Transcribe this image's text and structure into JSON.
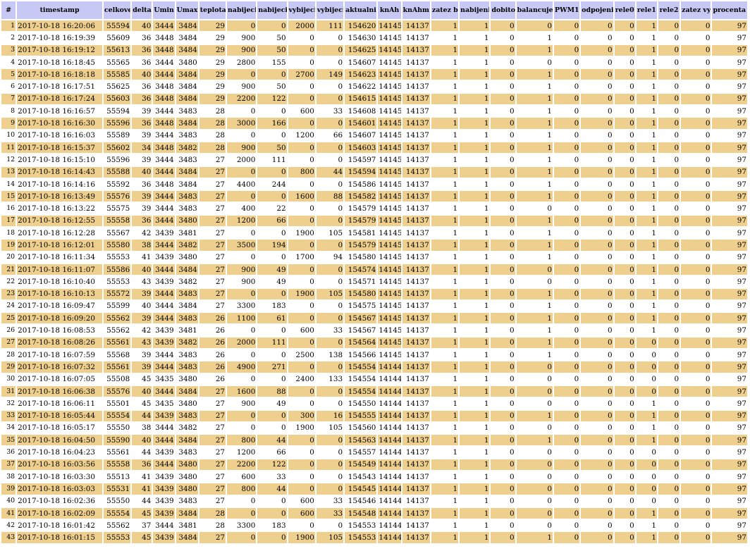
{
  "columns": [
    "#",
    "timestamp",
    "celkove napeti",
    "delta U",
    "Umin",
    "Umax",
    "teplota",
    "nabijeci proud",
    "nabijeci vykon",
    "vybijeci proud",
    "vybijeci vykon",
    "aktualni naboj",
    "knAh",
    "knAhm",
    "zatez bistabil",
    "nabijeni bistabil",
    "dobito",
    "balancuje",
    "PWM1",
    "odpojeni baterie",
    "rele0",
    "rele1",
    "rele2",
    "zatez vypnuta",
    "procenta baterie"
  ],
  "rows": [
    [
      "1",
      "2017-10-18 16:20:06",
      "55594",
      "40",
      "3444",
      "3484",
      "29",
      "0",
      "0",
      "2000",
      "111",
      "154620",
      "14145",
      "14137",
      "1",
      "1",
      "0",
      "0",
      "0",
      "0",
      "0",
      "1",
      "0",
      "0",
      "97"
    ],
    [
      "2",
      "2017-10-18 16:19:39",
      "55609",
      "36",
      "3448",
      "3484",
      "29",
      "900",
      "50",
      "0",
      "0",
      "154630",
      "14145",
      "14137",
      "1",
      "1",
      "0",
      "1",
      "0",
      "0",
      "0",
      "1",
      "0",
      "0",
      "97"
    ],
    [
      "3",
      "2017-10-18 16:19:12",
      "55613",
      "36",
      "3448",
      "3484",
      "29",
      "900",
      "50",
      "0",
      "0",
      "154625",
      "14145",
      "14137",
      "1",
      "1",
      "0",
      "1",
      "0",
      "0",
      "0",
      "1",
      "0",
      "0",
      "97"
    ],
    [
      "4",
      "2017-10-18 16:18:45",
      "55565",
      "36",
      "3444",
      "3480",
      "29",
      "2800",
      "155",
      "0",
      "0",
      "154607",
      "14145",
      "14137",
      "1",
      "1",
      "0",
      "0",
      "0",
      "0",
      "0",
      "1",
      "0",
      "0",
      "97"
    ],
    [
      "5",
      "2017-10-18 16:18:18",
      "55585",
      "40",
      "3444",
      "3484",
      "29",
      "0",
      "0",
      "2700",
      "149",
      "154623",
      "14145",
      "14137",
      "1",
      "1",
      "0",
      "1",
      "0",
      "0",
      "0",
      "1",
      "0",
      "0",
      "97"
    ],
    [
      "6",
      "2017-10-18 16:17:51",
      "55625",
      "36",
      "3448",
      "3484",
      "29",
      "900",
      "50",
      "0",
      "0",
      "154622",
      "14145",
      "14137",
      "1",
      "1",
      "0",
      "1",
      "0",
      "0",
      "0",
      "1",
      "0",
      "0",
      "97"
    ],
    [
      "7",
      "2017-10-18 16:17:24",
      "55603",
      "36",
      "3448",
      "3484",
      "29",
      "2200",
      "122",
      "0",
      "0",
      "154615",
      "14145",
      "14137",
      "1",
      "1",
      "0",
      "1",
      "0",
      "0",
      "0",
      "1",
      "0",
      "0",
      "97"
    ],
    [
      "8",
      "2017-10-18 16:16:57",
      "55594",
      "39",
      "3444",
      "3483",
      "28",
      "0",
      "0",
      "600",
      "33",
      "154608",
      "14145",
      "14137",
      "1",
      "1",
      "0",
      "1",
      "0",
      "0",
      "0",
      "1",
      "0",
      "0",
      "97"
    ],
    [
      "9",
      "2017-10-18 16:16:30",
      "55596",
      "36",
      "3448",
      "3484",
      "28",
      "3000",
      "166",
      "0",
      "0",
      "154601",
      "14145",
      "14137",
      "1",
      "1",
      "0",
      "1",
      "0",
      "0",
      "0",
      "1",
      "0",
      "0",
      "97"
    ],
    [
      "10",
      "2017-10-18 16:16:03",
      "55589",
      "39",
      "3444",
      "3483",
      "28",
      "0",
      "0",
      "1200",
      "66",
      "154607",
      "14145",
      "14137",
      "1",
      "1",
      "0",
      "1",
      "0",
      "0",
      "0",
      "1",
      "0",
      "0",
      "97"
    ],
    [
      "11",
      "2017-10-18 16:15:37",
      "55602",
      "34",
      "3448",
      "3482",
      "28",
      "900",
      "50",
      "0",
      "0",
      "154603",
      "14145",
      "14137",
      "1",
      "1",
      "0",
      "1",
      "0",
      "0",
      "0",
      "1",
      "0",
      "0",
      "97"
    ],
    [
      "12",
      "2017-10-18 16:15:10",
      "55596",
      "39",
      "3444",
      "3483",
      "27",
      "2000",
      "111",
      "0",
      "0",
      "154597",
      "14145",
      "14137",
      "1",
      "1",
      "0",
      "1",
      "0",
      "0",
      "0",
      "1",
      "0",
      "0",
      "97"
    ],
    [
      "13",
      "2017-10-18 16:14:43",
      "55588",
      "40",
      "3444",
      "3484",
      "27",
      "0",
      "0",
      "800",
      "44",
      "154594",
      "14145",
      "14137",
      "1",
      "1",
      "0",
      "1",
      "0",
      "0",
      "0",
      "1",
      "0",
      "0",
      "97"
    ],
    [
      "14",
      "2017-10-18 16:14:16",
      "55592",
      "36",
      "3448",
      "3484",
      "27",
      "4400",
      "244",
      "0",
      "0",
      "154586",
      "14145",
      "14137",
      "1",
      "1",
      "0",
      "1",
      "0",
      "0",
      "0",
      "1",
      "0",
      "0",
      "97"
    ],
    [
      "15",
      "2017-10-18 16:13:49",
      "55576",
      "39",
      "3444",
      "3483",
      "27",
      "0",
      "0",
      "1600",
      "88",
      "154582",
      "14145",
      "14137",
      "1",
      "1",
      "0",
      "1",
      "0",
      "0",
      "0",
      "1",
      "0",
      "0",
      "97"
    ],
    [
      "16",
      "2017-10-18 16:13:22",
      "55575",
      "39",
      "3444",
      "3483",
      "27",
      "400",
      "22",
      "0",
      "0",
      "154579",
      "14145",
      "14137",
      "1",
      "1",
      "0",
      "0",
      "0",
      "0",
      "0",
      "1",
      "0",
      "0",
      "97"
    ],
    [
      "17",
      "2017-10-18 16:12:55",
      "55558",
      "36",
      "3444",
      "3480",
      "27",
      "1200",
      "66",
      "0",
      "0",
      "154579",
      "14145",
      "14137",
      "1",
      "1",
      "0",
      "1",
      "0",
      "0",
      "0",
      "1",
      "0",
      "0",
      "97"
    ],
    [
      "18",
      "2017-10-18 16:12:28",
      "55567",
      "42",
      "3439",
      "3481",
      "27",
      "0",
      "0",
      "1900",
      "105",
      "154581",
      "14145",
      "14137",
      "1",
      "1",
      "0",
      "1",
      "0",
      "0",
      "0",
      "1",
      "0",
      "0",
      "97"
    ],
    [
      "19",
      "2017-10-18 16:12:01",
      "55580",
      "38",
      "3444",
      "3482",
      "27",
      "3500",
      "194",
      "0",
      "0",
      "154579",
      "14145",
      "14137",
      "1",
      "1",
      "0",
      "1",
      "0",
      "0",
      "0",
      "1",
      "0",
      "0",
      "97"
    ],
    [
      "20",
      "2017-10-18 16:11:34",
      "55553",
      "41",
      "3439",
      "3480",
      "27",
      "0",
      "0",
      "1700",
      "94",
      "154580",
      "14145",
      "14137",
      "1",
      "1",
      "0",
      "1",
      "0",
      "0",
      "0",
      "1",
      "0",
      "0",
      "97"
    ],
    [
      "21",
      "2017-10-18 16:11:07",
      "55586",
      "40",
      "3444",
      "3484",
      "27",
      "900",
      "49",
      "0",
      "0",
      "154574",
      "14145",
      "14137",
      "1",
      "1",
      "0",
      "0",
      "0",
      "0",
      "0",
      "1",
      "0",
      "0",
      "97"
    ],
    [
      "22",
      "2017-10-18 16:10:40",
      "55553",
      "43",
      "3439",
      "3482",
      "27",
      "900",
      "49",
      "0",
      "0",
      "154571",
      "14145",
      "14137",
      "1",
      "1",
      "0",
      "0",
      "0",
      "0",
      "0",
      "1",
      "0",
      "0",
      "97"
    ],
    [
      "23",
      "2017-10-18 16:10:13",
      "55572",
      "39",
      "3444",
      "3483",
      "27",
      "0",
      "0",
      "1900",
      "105",
      "154580",
      "14145",
      "14137",
      "1",
      "1",
      "0",
      "1",
      "0",
      "0",
      "0",
      "1",
      "0",
      "0",
      "97"
    ],
    [
      "24",
      "2017-10-18 16:09:47",
      "55599",
      "40",
      "3444",
      "3484",
      "27",
      "3300",
      "183",
      "0",
      "0",
      "154575",
      "14145",
      "14137",
      "1",
      "1",
      "0",
      "1",
      "0",
      "0",
      "0",
      "1",
      "0",
      "0",
      "97"
    ],
    [
      "25",
      "2017-10-18 16:09:20",
      "55562",
      "39",
      "3444",
      "3483",
      "26",
      "1100",
      "61",
      "0",
      "0",
      "154567",
      "14145",
      "14137",
      "1",
      "1",
      "0",
      "1",
      "0",
      "0",
      "0",
      "1",
      "0",
      "0",
      "97"
    ],
    [
      "26",
      "2017-10-18 16:08:53",
      "55562",
      "42",
      "3439",
      "3481",
      "26",
      "0",
      "0",
      "600",
      "33",
      "154567",
      "14145",
      "14137",
      "1",
      "1",
      "0",
      "1",
      "0",
      "0",
      "0",
      "1",
      "0",
      "0",
      "97"
    ],
    [
      "27",
      "2017-10-18 16:08:26",
      "55561",
      "43",
      "3439",
      "3482",
      "26",
      "2000",
      "111",
      "0",
      "0",
      "154564",
      "14145",
      "14137",
      "1",
      "1",
      "0",
      "1",
      "0",
      "0",
      "0",
      "0",
      "0",
      "0",
      "97"
    ],
    [
      "28",
      "2017-10-18 16:07:59",
      "55568",
      "39",
      "3444",
      "3483",
      "26",
      "0",
      "0",
      "2500",
      "138",
      "154566",
      "14145",
      "14137",
      "1",
      "1",
      "0",
      "1",
      "0",
      "0",
      "0",
      "0",
      "0",
      "0",
      "97"
    ],
    [
      "29",
      "2017-10-18 16:07:32",
      "55561",
      "39",
      "3444",
      "3483",
      "26",
      "4900",
      "271",
      "0",
      "0",
      "154554",
      "14144",
      "14137",
      "1",
      "1",
      "0",
      "0",
      "0",
      "0",
      "0",
      "0",
      "0",
      "0",
      "97"
    ],
    [
      "30",
      "2017-10-18 16:07:05",
      "55508",
      "45",
      "3435",
      "3480",
      "26",
      "0",
      "0",
      "2400",
      "133",
      "154554",
      "14144",
      "14137",
      "1",
      "1",
      "0",
      "0",
      "0",
      "0",
      "0",
      "0",
      "0",
      "0",
      "97"
    ],
    [
      "31",
      "2017-10-18 16:06:38",
      "55576",
      "40",
      "3444",
      "3484",
      "27",
      "1600",
      "88",
      "0",
      "0",
      "154554",
      "14144",
      "14137",
      "1",
      "1",
      "0",
      "0",
      "0",
      "0",
      "0",
      "0",
      "0",
      "0",
      "97"
    ],
    [
      "32",
      "2017-10-18 16:06:11",
      "55501",
      "45",
      "3435",
      "3480",
      "27",
      "900",
      "49",
      "0",
      "0",
      "154550",
      "14144",
      "14137",
      "1",
      "1",
      "0",
      "0",
      "0",
      "0",
      "0",
      "1",
      "0",
      "0",
      "97"
    ],
    [
      "33",
      "2017-10-18 16:05:44",
      "55554",
      "44",
      "3439",
      "3483",
      "27",
      "0",
      "0",
      "300",
      "16",
      "154555",
      "14144",
      "14137",
      "1",
      "1",
      "0",
      "1",
      "0",
      "0",
      "0",
      "1",
      "0",
      "0",
      "97"
    ],
    [
      "34",
      "2017-10-18 16:05:17",
      "55550",
      "38",
      "3444",
      "3482",
      "27",
      "0",
      "0",
      "1900",
      "105",
      "154560",
      "14144",
      "14137",
      "1",
      "1",
      "0",
      "0",
      "0",
      "0",
      "0",
      "1",
      "0",
      "0",
      "97"
    ],
    [
      "35",
      "2017-10-18 16:04:50",
      "55590",
      "40",
      "3444",
      "3484",
      "27",
      "800",
      "44",
      "0",
      "0",
      "154563",
      "14144",
      "14137",
      "1",
      "1",
      "0",
      "1",
      "0",
      "0",
      "0",
      "1",
      "0",
      "0",
      "97"
    ],
    [
      "36",
      "2017-10-18 16:04:23",
      "55561",
      "44",
      "3439",
      "3483",
      "27",
      "1200",
      "66",
      "0",
      "0",
      "154557",
      "14144",
      "14137",
      "1",
      "1",
      "0",
      "0",
      "0",
      "0",
      "0",
      "0",
      "0",
      "0",
      "97"
    ],
    [
      "37",
      "2017-10-18 16:03:56",
      "55558",
      "36",
      "3444",
      "3480",
      "27",
      "2200",
      "122",
      "0",
      "0",
      "154549",
      "14144",
      "14137",
      "1",
      "1",
      "0",
      "0",
      "0",
      "0",
      "0",
      "0",
      "0",
      "0",
      "97"
    ],
    [
      "38",
      "2017-10-18 16:03:30",
      "55513",
      "41",
      "3439",
      "3480",
      "27",
      "600",
      "33",
      "0",
      "0",
      "154543",
      "14144",
      "14137",
      "1",
      "1",
      "0",
      "0",
      "0",
      "0",
      "0",
      "0",
      "0",
      "0",
      "97"
    ],
    [
      "39",
      "2017-10-18 16:03:03",
      "55531",
      "41",
      "3439",
      "3480",
      "27",
      "800",
      "44",
      "0",
      "0",
      "154545",
      "14144",
      "14137",
      "1",
      "1",
      "0",
      "0",
      "0",
      "0",
      "0",
      "0",
      "0",
      "0",
      "97"
    ],
    [
      "40",
      "2017-10-18 16:02:36",
      "55550",
      "44",
      "3439",
      "3483",
      "27",
      "0",
      "0",
      "600",
      "33",
      "154546",
      "14144",
      "14137",
      "1",
      "1",
      "0",
      "0",
      "0",
      "0",
      "0",
      "0",
      "0",
      "0",
      "97"
    ],
    [
      "41",
      "2017-10-18 16:02:09",
      "55554",
      "45",
      "3439",
      "3484",
      "28",
      "0",
      "0",
      "600",
      "33",
      "154548",
      "14144",
      "14137",
      "1",
      "1",
      "0",
      "0",
      "0",
      "0",
      "0",
      "1",
      "0",
      "0",
      "97"
    ],
    [
      "42",
      "2017-10-18 16:01:42",
      "55562",
      "37",
      "3444",
      "3481",
      "28",
      "3300",
      "183",
      "0",
      "0",
      "154553",
      "14144",
      "14137",
      "1",
      "1",
      "0",
      "0",
      "0",
      "0",
      "0",
      "1",
      "0",
      "0",
      "97"
    ],
    [
      "43",
      "2017-10-18 16:01:15",
      "55553",
      "45",
      "3439",
      "3484",
      "27",
      "0",
      "0",
      "1900",
      "105",
      "154553",
      "14144",
      "14137",
      "1",
      "1",
      "0",
      "1",
      "0",
      "0",
      "0",
      "1",
      "0",
      "0",
      "97"
    ]
  ],
  "colors": {
    "header_bg": "#c7c9f4",
    "odd_row_bg": "#eecf8d",
    "even_row_bg": "#ffffff"
  }
}
